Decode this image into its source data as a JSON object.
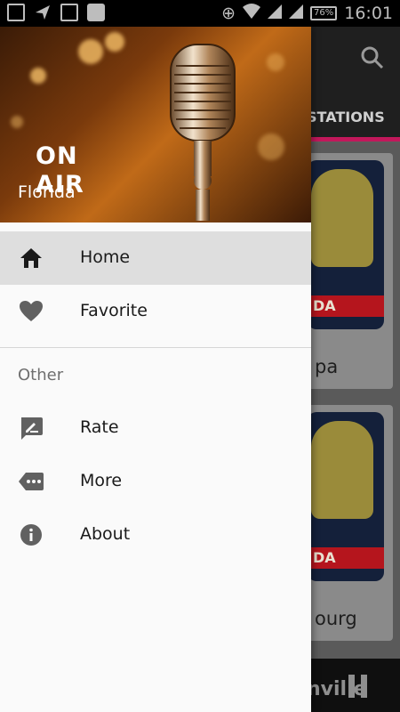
{
  "status_bar": {
    "battery": "76%",
    "time": "16:01"
  },
  "app": {
    "tab_label": "STATIONS",
    "cards": [
      {
        "name_fragment": "pa",
        "banner": "DA"
      },
      {
        "name_fragment": "ourg",
        "banner": "DA"
      }
    ],
    "now_playing_fragment": "nville"
  },
  "drawer": {
    "header": {
      "on_air_line1": "ON",
      "on_air_line2": "AIR",
      "title": "Florida"
    },
    "items": [
      {
        "label": "Home",
        "icon": "home-icon",
        "selected": true
      },
      {
        "label": "Favorite",
        "icon": "heart-icon",
        "selected": false
      }
    ],
    "section_title": "Other",
    "other_items": [
      {
        "label": "Rate",
        "icon": "rate-icon"
      },
      {
        "label": "More",
        "icon": "more-icon"
      },
      {
        "label": "About",
        "icon": "info-icon"
      }
    ]
  },
  "colors": {
    "accent": "#c2185b",
    "drawer_bg": "#fafafa",
    "selected_bg": "#dedede",
    "icon": "#616161",
    "scrim": "#5a5a5a"
  }
}
